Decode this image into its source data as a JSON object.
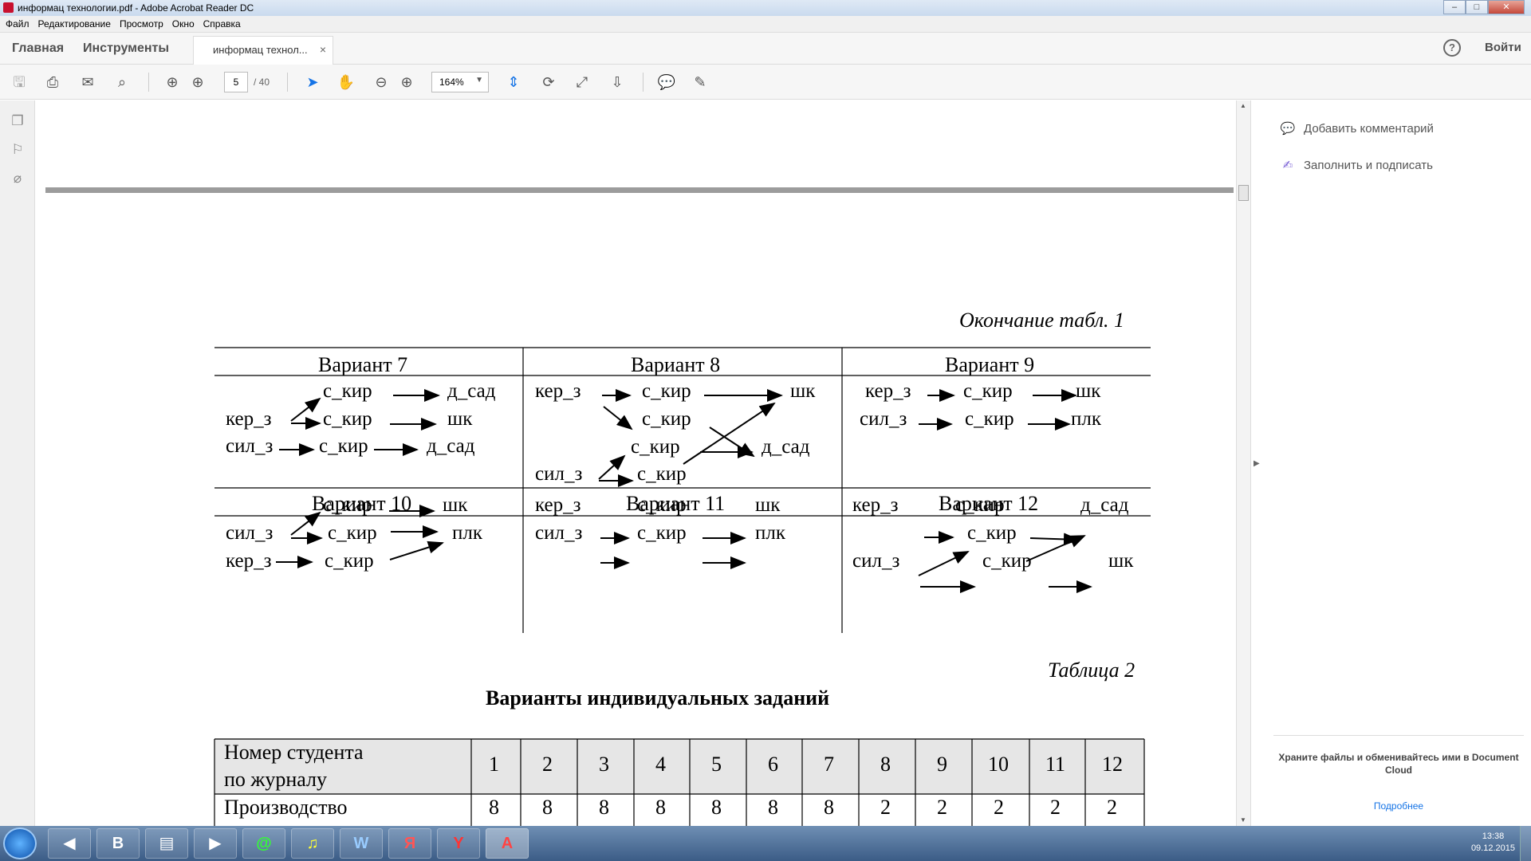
{
  "window": {
    "title": "информац технологии.pdf - Adobe Acrobat Reader DC",
    "min": "‒",
    "max": "□",
    "close": "✕"
  },
  "menu": [
    "Файл",
    "Редактирование",
    "Просмотр",
    "Окно",
    "Справка"
  ],
  "nav": {
    "home": "Главная",
    "tools": "Инструменты",
    "doc_tab": "информац технол...",
    "doc_tab_close": "×",
    "help": "?",
    "login": "Войти"
  },
  "toolbar": {
    "page_current": "5",
    "page_total": "/ 40",
    "zoom": "164%"
  },
  "right_panel": {
    "items": [
      "Добавить комментарий",
      "Заполнить и подписать"
    ],
    "promo": "Храните файлы и обменивайтесь ими в Document Cloud",
    "promo_link": "Подробнее"
  },
  "page": {
    "continuation": "Окончание табл. 1",
    "variants": [
      {
        "title": "Вариант 7",
        "words": [
          "с_кир",
          "д_сад",
          "кер_з",
          "с_кир",
          "шк",
          "сил_з",
          "с_кир",
          "д_сад"
        ]
      },
      {
        "title": "Вариант 8",
        "words": [
          "кер_з",
          "с_кир",
          "шк",
          "с_кир",
          "с_кир",
          "д_сад",
          "сил_з",
          "с_кир"
        ]
      },
      {
        "title": "Вариант 9",
        "words": [
          "кер_з",
          "с_кир",
          "шк",
          "сил_з",
          "с_кир",
          "плк"
        ]
      },
      {
        "title": "Вариант 10",
        "words": [
          "с_кир",
          "шк",
          "сил_з",
          "с_кир",
          "плк",
          "кер_з",
          "с_кир"
        ]
      },
      {
        "title": "Вариант 11",
        "words": [
          "кер_з",
          "с_кир",
          "шк",
          "сил_з",
          "с_кир",
          "плк"
        ]
      },
      {
        "title": "Вариант 12",
        "words": [
          "кер_з",
          "с_кир",
          "д_сад",
          "с_кир",
          "сил_з",
          "с_кир",
          "шк"
        ]
      }
    ],
    "table2_label": "Таблица 2",
    "table2_title": "Варианты индивидуальных заданий",
    "table2": {
      "header_line1": "Номер студента",
      "header_line2": "по журналу",
      "columns": [
        "1",
        "2",
        "3",
        "4",
        "5",
        "6",
        "7",
        "8",
        "9",
        "10",
        "11",
        "12"
      ],
      "row_label": "Производство",
      "row_values": [
        "8",
        "8",
        "8",
        "8",
        "8",
        "8",
        "8",
        "2",
        "2",
        "2",
        "2",
        "2"
      ]
    }
  },
  "taskbar": {
    "apps": [
      "◀",
      "B",
      "▤",
      "▶",
      "@",
      "♫",
      "W",
      "Я",
      "Y",
      "A"
    ],
    "clock_time": "13:38",
    "clock_date": "09.12.2015"
  }
}
